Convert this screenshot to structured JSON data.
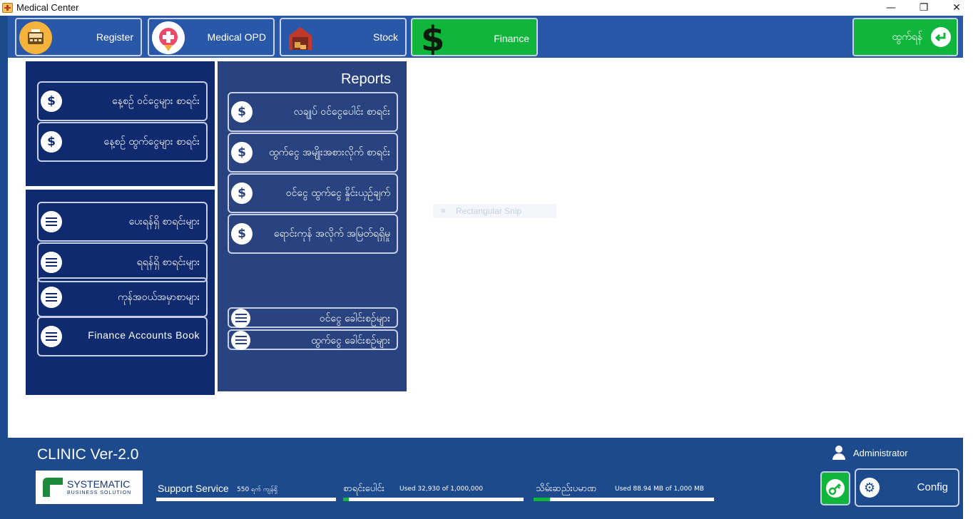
{
  "window": {
    "title": "Medical Center",
    "minimize": "—",
    "restore": "❐",
    "close": "✕"
  },
  "toolbar": {
    "register": "Register",
    "medical_opd": "Medical OPD",
    "stock": "Stock",
    "finance": "Finance",
    "exit": "ထွက်ရန်",
    "active_tab": "Finance"
  },
  "left_top": {
    "items": [
      {
        "label": "နေ့စဉ် ဝင်ငွေများ စာရင်း",
        "icon": "dollar-icon"
      },
      {
        "label": "နေ့စဉ် ထွက်ငွေများ စာရင်း",
        "icon": "dollar-icon"
      }
    ]
  },
  "left_bottom": {
    "items": [
      {
        "label": "ပေးရန်ရှိ စာရင်းများ",
        "icon": "list-icon"
      },
      {
        "label": "ရရန်ရှိ စာရင်းများ",
        "icon": "list-icon"
      },
      {
        "label": "ကုန်အဝယ်အမှာစာများ",
        "icon": "list-icon"
      },
      {
        "label": "Finance Accounts Book",
        "icon": "list-icon"
      }
    ]
  },
  "reports": {
    "title": "Reports",
    "items": [
      {
        "label": "လချုပ် ဝင်ငွေပေါင်း စာရင်း",
        "icon": "dollar-icon"
      },
      {
        "label": "ထွက်ငွေ အမျိုးအစားလိုက် စာရင်း",
        "icon": "dollar-icon"
      },
      {
        "label": "ဝင်ငွေ ထွက်ငွေ နှိုင်းယှဉ်ချက်",
        "icon": "dollar-icon"
      },
      {
        "label": "ရောင်းကုန် အလိုက် အမြတ်ရရှိမှု",
        "icon": "dollar-icon"
      }
    ],
    "heads": [
      {
        "label": "ဝင်ငွေ ခေါင်းစဉ်များ",
        "icon": "list-icon"
      },
      {
        "label": "ထွက်ငွေ ခေါင်းစဉ်များ",
        "icon": "list-icon"
      }
    ]
  },
  "snip_popup": "Rectangular Snip",
  "footer": {
    "version": "CLINIC Ver-2.0",
    "logo_line1": "SYSTEMATIC",
    "logo_line2": "BUSINESS SOLUTION",
    "support_label": "Support Service",
    "support_value": "550 ရက် ကျန်ရှိ",
    "support_progress": 1.0,
    "records_label": "စာရင်းပေါင်း",
    "records_value": "Used 32,930 of 1,000,000",
    "records_progress": 0.033,
    "storage_label": "သိမ်းဆည်းပမာဏ",
    "storage_value": "Used 88.94 MB of 1,000 MB",
    "storage_progress": 0.089,
    "user": "Administrator",
    "config": "Config"
  },
  "colors": {
    "toolbar_blue": "#2a58a8",
    "panel_navy": "#0f2a6e",
    "panel_slate": "#28437f",
    "footer_blue": "#1c4a8c",
    "accent_green": "#10b53c"
  }
}
